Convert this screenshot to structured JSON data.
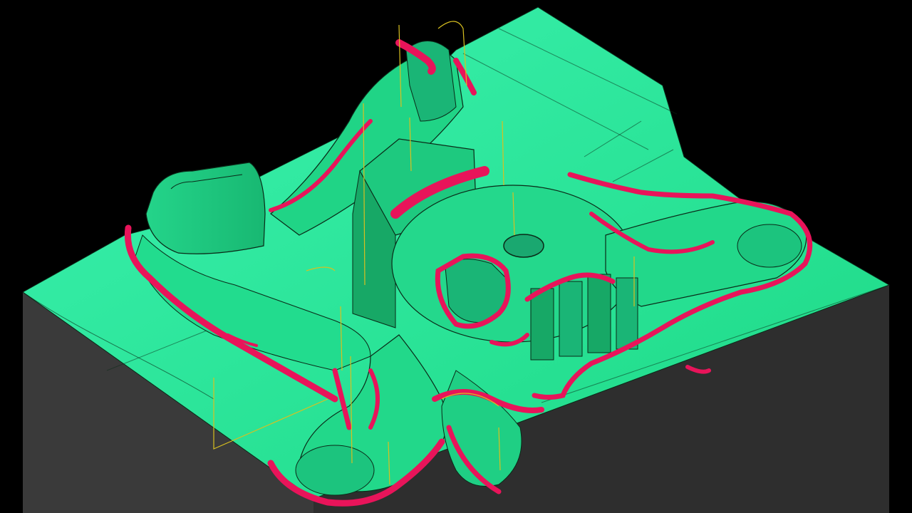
{
  "viewport": {
    "background": "#000000",
    "content": "cam-toolpath-3d-model"
  },
  "colors": {
    "surface": "#20e08c",
    "surface_light": "#3cf2b0",
    "surface_highlight": "#5ff7c9",
    "surface_shadow": "#13a865",
    "block_side_dark": "#3a3a3a",
    "block_side_front": "#2c2c2c",
    "toolpath": "#e8145a",
    "linking_moves": "#d8c020",
    "edge_lines": "#0a2a18"
  },
  "icons": {
    "model": "machined-part-icon",
    "toolpath": "toolpath-icon"
  }
}
